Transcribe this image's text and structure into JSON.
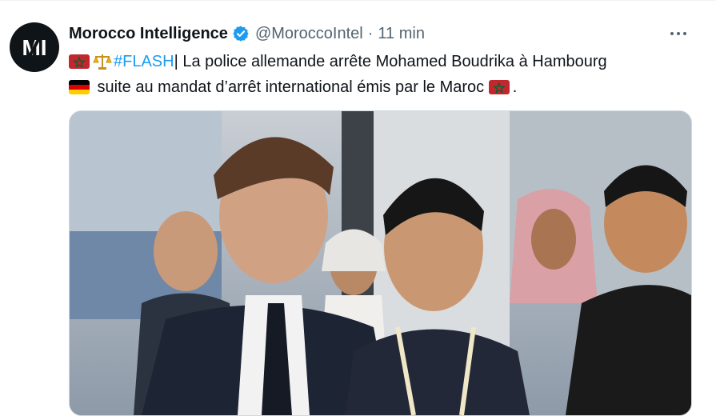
{
  "account": {
    "name": "Morocco Intelligence",
    "handle": "@MoroccoIntel",
    "separator": "·",
    "timestamp": "11 min",
    "avatar_text": "MI",
    "verified": true
  },
  "tweet": {
    "hashtag": "#FLASH",
    "line1_after_hashtag": "| La police allemande arrête Mohamed Boudrika à Hambourg",
    "line2_text": " suite au mandat d’arrêt international émis par le Maroc ",
    "line2_end": "."
  },
  "icons": {
    "more": "more-horizontal-icon",
    "verified": "verified-badge-icon",
    "flag_morocco": "morocco-flag-icon",
    "flag_germany": "germany-flag-icon",
    "scales": "balance-scale-icon"
  },
  "colors": {
    "link": "#1d9bf0",
    "text": "#0f1419",
    "muted": "#536471",
    "verified": "#1d9bf0"
  }
}
